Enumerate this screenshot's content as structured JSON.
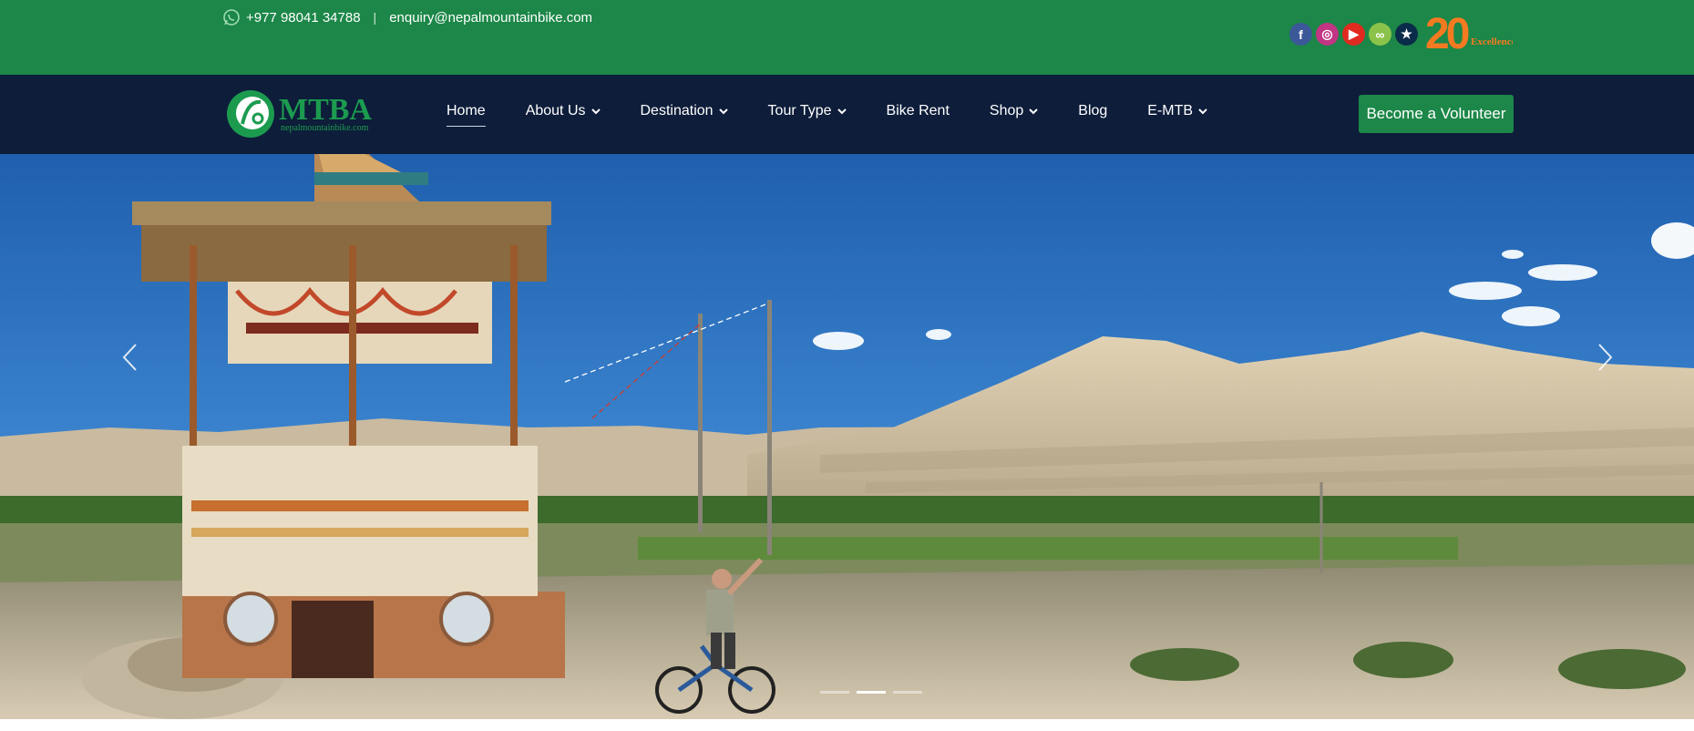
{
  "topbar": {
    "phone": "+977 98041 34788",
    "separator": "|",
    "email": "enquiry@nepalmountainbike.com",
    "socials": [
      {
        "name": "facebook",
        "glyph": "f",
        "color": "#3b5998"
      },
      {
        "name": "instagram",
        "glyph": "◎",
        "color": "#c13584"
      },
      {
        "name": "youtube",
        "glyph": "▶",
        "color": "#e02a20"
      },
      {
        "name": "tripadvisor",
        "glyph": "∞",
        "color": "#8bc34a"
      },
      {
        "name": "star-review",
        "glyph": "★",
        "color": "#0b2b4a"
      }
    ],
    "anniversary": {
      "number": "20",
      "text": "Excellence"
    }
  },
  "logo": {
    "brand": "MTBA",
    "site": "nepalmountainbike.com"
  },
  "nav": {
    "items": [
      {
        "label": "Home",
        "dropdown": false,
        "active": true
      },
      {
        "label": "About Us",
        "dropdown": true,
        "active": false
      },
      {
        "label": "Destination",
        "dropdown": true,
        "active": false
      },
      {
        "label": "Tour Type",
        "dropdown": true,
        "active": false
      },
      {
        "label": "Bike Rent",
        "dropdown": false,
        "active": false
      },
      {
        "label": "Shop",
        "dropdown": true,
        "active": false
      },
      {
        "label": "Blog",
        "dropdown": false,
        "active": false
      },
      {
        "label": "E-MTB",
        "dropdown": true,
        "active": false
      }
    ],
    "cta_label": "Become a Volunteer"
  },
  "hero": {
    "slides_total": 3,
    "active_slide": 2
  },
  "colors": {
    "brand_green": "#1c8748",
    "nav_navy": "#0d1d3a"
  }
}
